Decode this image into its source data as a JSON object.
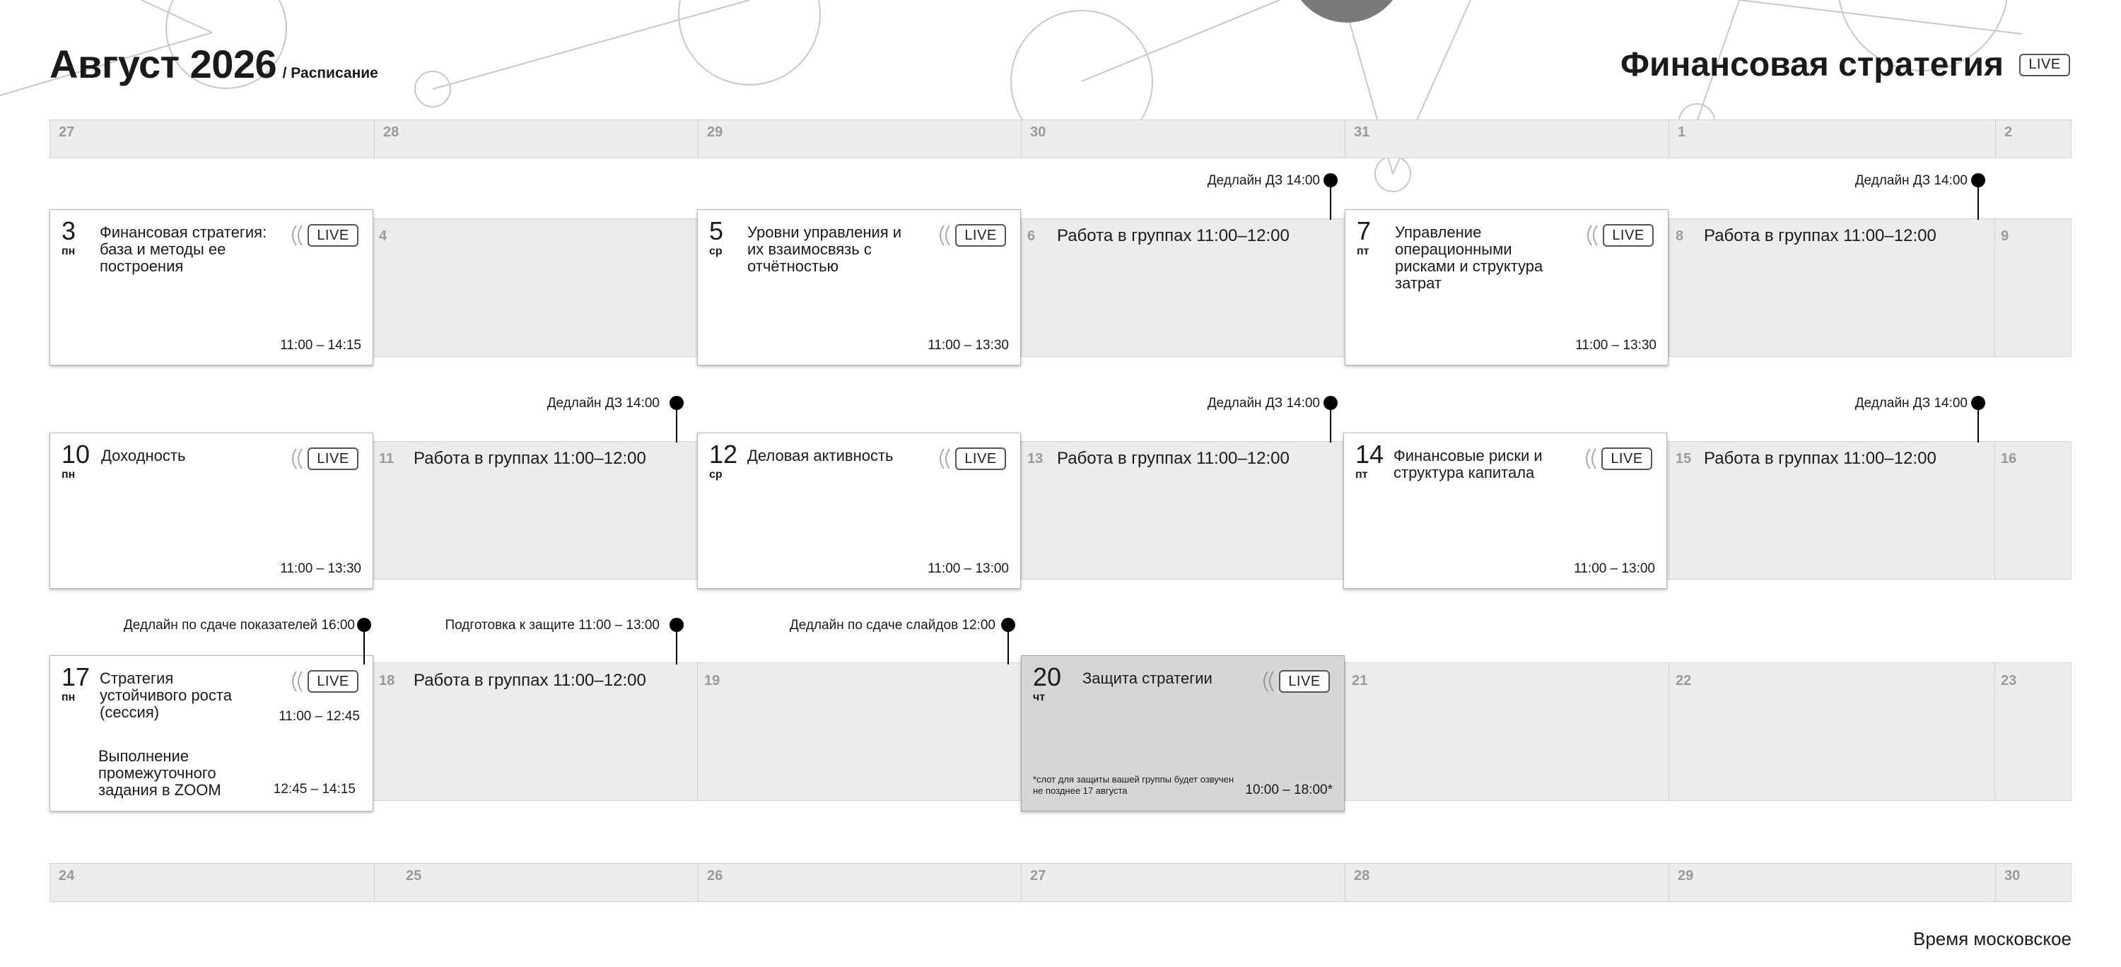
{
  "header": {
    "month": "Август 2026",
    "subtitle": "/ Расписание",
    "course_title": "Финансовая стратегия",
    "live_label": "LIVE"
  },
  "top_strip": [
    "27",
    "28",
    "29",
    "30",
    "31",
    "1",
    "2"
  ],
  "bottom_strip": [
    "24",
    "25",
    "26",
    "27",
    "28",
    "29",
    "30"
  ],
  "weeks": [
    {
      "days": [
        {
          "num": "3",
          "weekday": "пн",
          "title": "Финансовая стратегия: база и методы ее построения",
          "time": "11:00 – 14:15",
          "live": "LIVE"
        },
        {
          "num": "4"
        },
        {
          "num": "5",
          "weekday": "ср",
          "title": "Уровни управления и их взаимосвязь с отчётностью",
          "time": "11:00 – 13:30",
          "live": "LIVE"
        },
        {
          "num": "6",
          "text": "Работа в группах 11:00–12:00"
        },
        {
          "num": "7",
          "weekday": "пт",
          "title": "Управление операционными рисками и структура затрат",
          "time": "11:00 – 13:30",
          "live": "LIVE"
        },
        {
          "num": "8",
          "text": "Работа в группах 11:00–12:00"
        },
        {
          "num": "9"
        }
      ],
      "pins": [
        "Дедлайн ДЗ 14:00",
        "Дедлайн ДЗ 14:00"
      ]
    },
    {
      "days": [
        {
          "num": "10",
          "weekday": "пн",
          "title": "Доходность",
          "time": "11:00 – 13:30",
          "live": "LIVE"
        },
        {
          "num": "11",
          "text": "Работа в группах 11:00–12:00"
        },
        {
          "num": "12",
          "weekday": "ср",
          "title": "Деловая активность",
          "time": "11:00 – 13:00",
          "live": "LIVE"
        },
        {
          "num": "13",
          "text": "Работа в группах 11:00–12:00"
        },
        {
          "num": "14",
          "weekday": "пт",
          "title": "Финансовые риски и структура капитала",
          "time": "11:00 – 13:00",
          "live": "LIVE"
        },
        {
          "num": "15",
          "text": "Работа в группах 11:00–12:00"
        },
        {
          "num": "16"
        }
      ],
      "pins": [
        "Дедлайн ДЗ 14:00",
        "Дедлайн ДЗ 14:00",
        "Дедлайн ДЗ 14:00"
      ]
    },
    {
      "days": [
        {
          "num": "17",
          "weekday": "пн",
          "title": "Стратегия устойчивого роста (сессия)",
          "time": "11:00 – 12:45",
          "live": "LIVE",
          "subtitle": "Выполнение промежуточного задания в ZOOM",
          "subtime": "12:45 – 14:15"
        },
        {
          "num": "18",
          "text": "Работа в группах 11:00–12:00"
        },
        {
          "num": "19"
        },
        {
          "num": "20",
          "weekday": "чт",
          "title": "Защита стратегии",
          "time": "10:00 – 18:00*",
          "live": "LIVE",
          "note": "*слот для защиты вашей группы будет озвучен не позднее 17 августа"
        },
        {
          "num": "21"
        },
        {
          "num": "22"
        },
        {
          "num": "23"
        }
      ],
      "pins": [
        "Дедлайн по сдаче показателей 16:00",
        "Подготовка к защите 11:00 – 13:00",
        "Дедлайн по сдаче слайдов 12:00"
      ]
    }
  ],
  "footer": {
    "note": "Время московское"
  }
}
